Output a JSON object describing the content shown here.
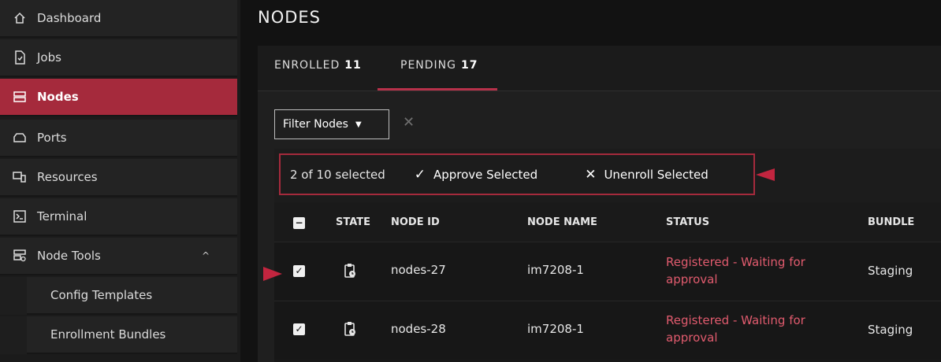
{
  "sidebar": {
    "items": [
      {
        "label": "Dashboard",
        "icon": "home-icon"
      },
      {
        "label": "Jobs",
        "icon": "jobs-icon"
      },
      {
        "label": "Nodes",
        "icon": "nodes-icon",
        "active": true
      },
      {
        "label": "Ports",
        "icon": "ports-icon"
      },
      {
        "label": "Resources",
        "icon": "resources-icon"
      },
      {
        "label": "Terminal",
        "icon": "terminal-icon"
      },
      {
        "label": "Node Tools",
        "icon": "node-tools-icon",
        "expanded": true,
        "caret": "^"
      }
    ],
    "sub_items": [
      {
        "label": "Config Templates"
      },
      {
        "label": "Enrollment Bundles"
      }
    ],
    "active_color": "#a52a3c"
  },
  "page": {
    "title": "NODES"
  },
  "tabs": [
    {
      "label": "ENROLLED",
      "count": "11"
    },
    {
      "label": "PENDING",
      "count": "17",
      "active": true
    }
  ],
  "filter": {
    "label": "Filter Nodes",
    "clear": "✕"
  },
  "selection": {
    "count_text": "2 of 10 selected",
    "approve": {
      "icon": "✓",
      "label": "Approve Selected"
    },
    "unenroll": {
      "icon": "✕",
      "label": "Unenroll Selected"
    },
    "highlight_color": "#c2253f"
  },
  "table": {
    "headers": [
      "STATE",
      "NODE ID",
      "NODE NAME",
      "STATUS",
      "BUNDLE"
    ],
    "rows": [
      {
        "checked": true,
        "state_icon": "clipboard-clock-icon",
        "node_id": "nodes-27",
        "node_name": "im7208-1",
        "status": "Registered - Waiting for approval",
        "bundle": "Staging"
      },
      {
        "checked": true,
        "state_icon": "clipboard-clock-icon",
        "node_id": "nodes-28",
        "node_name": "im7208-1",
        "status": "Registered - Waiting for approval",
        "bundle": "Staging"
      }
    ]
  }
}
